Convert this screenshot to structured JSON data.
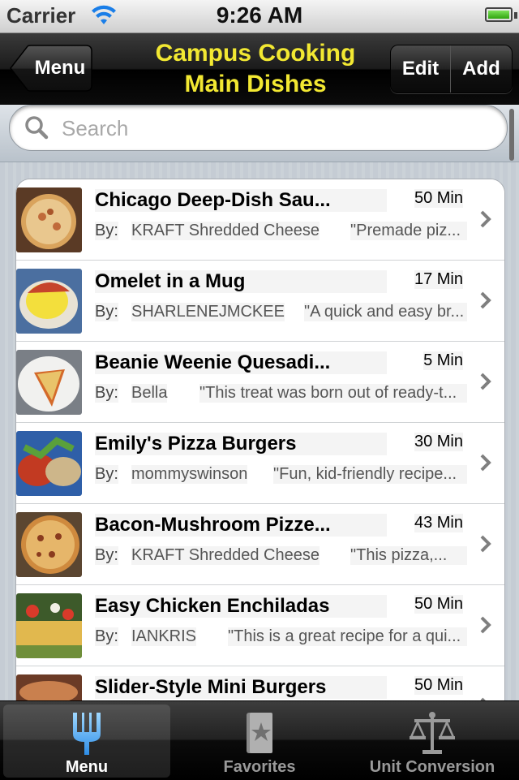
{
  "status": {
    "carrier": "Carrier",
    "time": "9:26 AM"
  },
  "nav": {
    "back_label": "Menu",
    "title_line1": "Campus Cooking",
    "title_line2": "Main Dishes",
    "edit_label": "Edit",
    "add_label": "Add"
  },
  "search": {
    "placeholder": "Search"
  },
  "colors": {
    "title_yellow": "#f2e832",
    "tab_selected_icon": "#5fb8ff"
  },
  "recipes": [
    {
      "title": "Chicago Deep-Dish Sau...",
      "time": "50 Min",
      "by": "By:",
      "author": "KRAFT Shredded Cheese",
      "desc": "\"Premade piz..."
    },
    {
      "title": "Omelet in a Mug",
      "time": "17 Min",
      "by": "By:",
      "author": "SHARLENEJMCKEE",
      "desc": "\"A quick and easy br..."
    },
    {
      "title": "Beanie Weenie Quesadi...",
      "time": "5 Min",
      "by": "By:",
      "author": "Bella",
      "desc": "\"This treat was born out of ready-t..."
    },
    {
      "title": "Emily's Pizza Burgers",
      "time": "30 Min",
      "by": "By:",
      "author": "mommyswinson",
      "desc": "\"Fun, kid-friendly recipe..."
    },
    {
      "title": "Bacon-Mushroom Pizze...",
      "time": "43 Min",
      "by": "By:",
      "author": "KRAFT Shredded Cheese",
      "desc": "\"This pizza,..."
    },
    {
      "title": "Easy Chicken Enchiladas",
      "time": "50 Min",
      "by": "By:",
      "author": "IANKRIS",
      "desc": "\"This is a great recipe for a qui..."
    },
    {
      "title": "Slider-Style Mini Burgers",
      "time": "50 Min",
      "by": "",
      "author": "",
      "desc": ""
    }
  ],
  "tabs": [
    {
      "label": "Menu",
      "icon": "fork-icon"
    },
    {
      "label": "Favorites",
      "icon": "star-book-icon"
    },
    {
      "label": "Unit Conversion",
      "icon": "scale-icon"
    }
  ]
}
